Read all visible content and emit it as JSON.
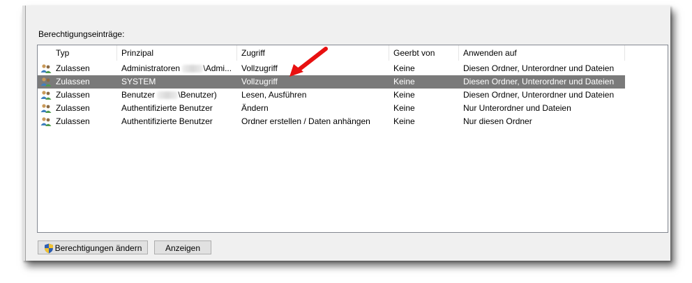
{
  "section_label": "Berechtigungseinträge:",
  "columns": [
    "Typ",
    "Prinzipal",
    "Zugriff",
    "Geerbt von",
    "Anwenden auf"
  ],
  "rows": [
    {
      "typ": "Zulassen",
      "prinzipal_pre": "Administratoren",
      "prinzipal_post": "\\Admi...",
      "zugriff": "Vollzugriff",
      "geerbt": "Keine",
      "anwenden": "Diesen Ordner, Unterordner und Dateien"
    },
    {
      "typ": "Zulassen",
      "prinzipal": "SYSTEM",
      "zugriff": "Vollzugriff",
      "geerbt": "Keine",
      "anwenden": "Diesen Ordner, Unterordner und Dateien",
      "selected": true
    },
    {
      "typ": "Zulassen",
      "prinzipal_pre": "Benutzer",
      "prinzipal_post": "\\Benutzer)",
      "zugriff": "Lesen, Ausführen",
      "geerbt": "Keine",
      "anwenden": "Diesen Ordner, Unterordner und Dateien"
    },
    {
      "typ": "Zulassen",
      "prinzipal": "Authentifizierte Benutzer",
      "zugriff": "Ändern",
      "geerbt": "Keine",
      "anwenden": "Nur Unterordner und Dateien"
    },
    {
      "typ": "Zulassen",
      "prinzipal": "Authentifizierte Benutzer",
      "zugriff": "Ordner erstellen / Daten anhängen",
      "geerbt": "Keine",
      "anwenden": "Nur diesen Ordner"
    }
  ],
  "buttons": {
    "change_permissions": "Berechtigungen ändern",
    "view": "Anzeigen"
  },
  "colors": {
    "selection": "#7a7a7a",
    "annotation_arrow": "#e81010"
  },
  "icons": {
    "row_icon": "users-icon",
    "button_icon": "uac-shield-icon",
    "annotation": "red-arrow-icon"
  }
}
